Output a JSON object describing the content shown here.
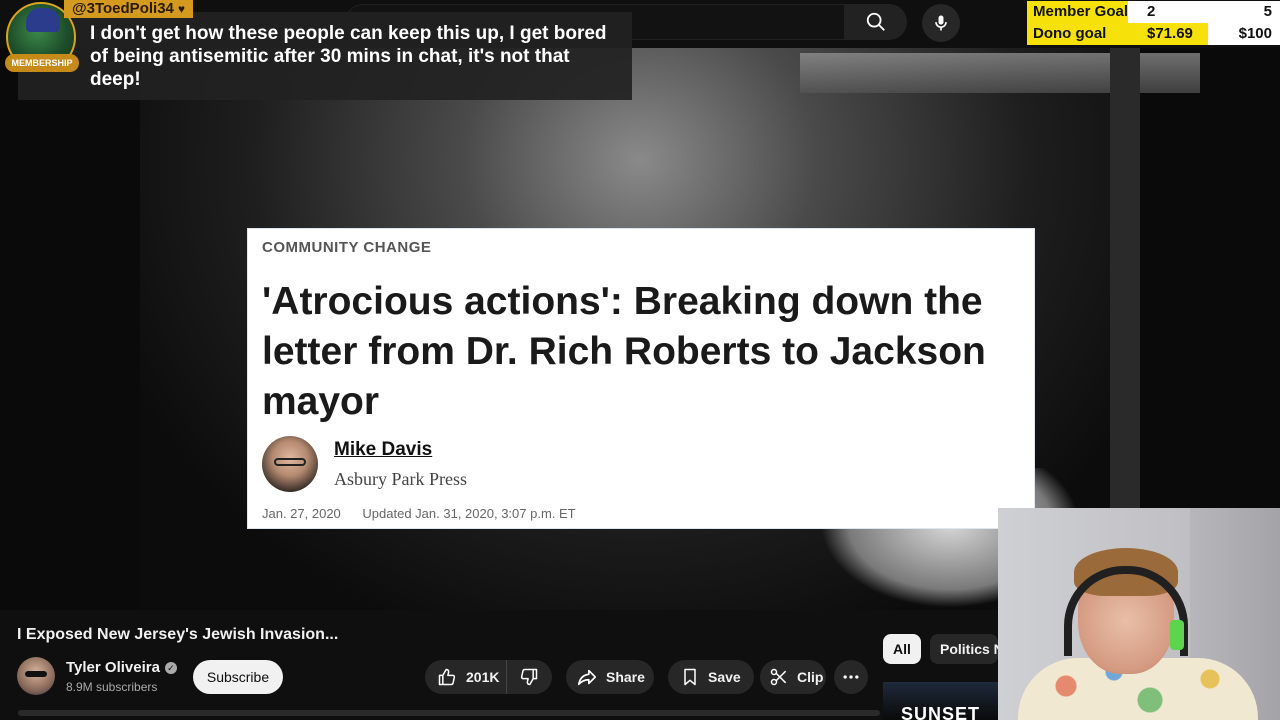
{
  "goals": {
    "member": {
      "label": "Member Goal",
      "current": "2",
      "target": "5",
      "progress": 0.4
    },
    "dono": {
      "label": "Dono goal",
      "current": "$71.69",
      "target": "$100",
      "progress": 0.717
    }
  },
  "chat": {
    "username": "@3ToedPoli34",
    "badge": "MEMBERSHIP",
    "message": "I don't get how these people can keep this up, I get bored of being antisemitic after 30 mins in chat, it's not that deep!"
  },
  "article": {
    "kicker": "COMMUNITY CHANGE",
    "headline": "'Atrocious actions': Breaking down the letter from Dr. Rich Roberts to Jackson mayor",
    "author": "Mike Davis",
    "publisher": "Asbury Park Press",
    "date": "Jan. 27, 2020",
    "updated": "Updated Jan. 31, 2020, 3:07 p.m. ET"
  },
  "video": {
    "title": "I Exposed New Jersey's Jewish Invasion...",
    "channel": "Tyler Oliveira",
    "subscribers": "8.9M subscribers",
    "subscribe_label": "Subscribe",
    "likes": "201K",
    "share_label": "Share",
    "save_label": "Save",
    "clip_label": "Clip"
  },
  "chips": {
    "all": "All",
    "politics": "Politics News"
  },
  "related": {
    "thumb_text": "SUNSET"
  },
  "icons": {
    "search": "search-icon",
    "mic": "mic-icon",
    "like": "thumbs-up-icon",
    "dislike": "thumbs-down-icon",
    "share": "share-icon",
    "save": "bookmark-icon",
    "clip": "scissors-icon",
    "more": "more-icon",
    "verified": "verified-icon"
  },
  "colors": {
    "goal_fill": "#f7e10a",
    "member_gold": "#d39a1f",
    "background": "#0f0f0f"
  }
}
